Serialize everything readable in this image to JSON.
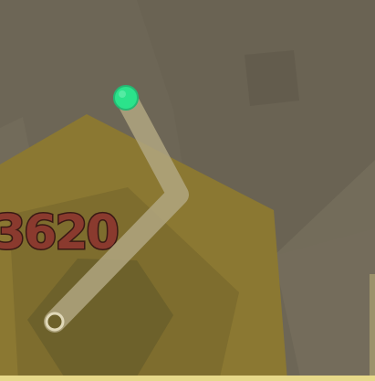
{
  "hud": {
    "score": "3620"
  },
  "colors": {
    "background": "#6d6656",
    "background_shape_dark": "#665f51",
    "background_shape_light": "#77705f",
    "territory_fill": "#8c7a33",
    "territory_inner": "#7d6c2e",
    "territory_core": "#6b5f2b",
    "trail": "#ada37d",
    "player": "#2be38b",
    "player_outline": "#25b873",
    "score_fill": "#8a3a2e",
    "score_stroke": "#3a1a14",
    "bottom_border": "#e7d98a"
  },
  "icons": {
    "player": "player-dot-icon",
    "trail_end": "trail-end-ring-icon"
  }
}
